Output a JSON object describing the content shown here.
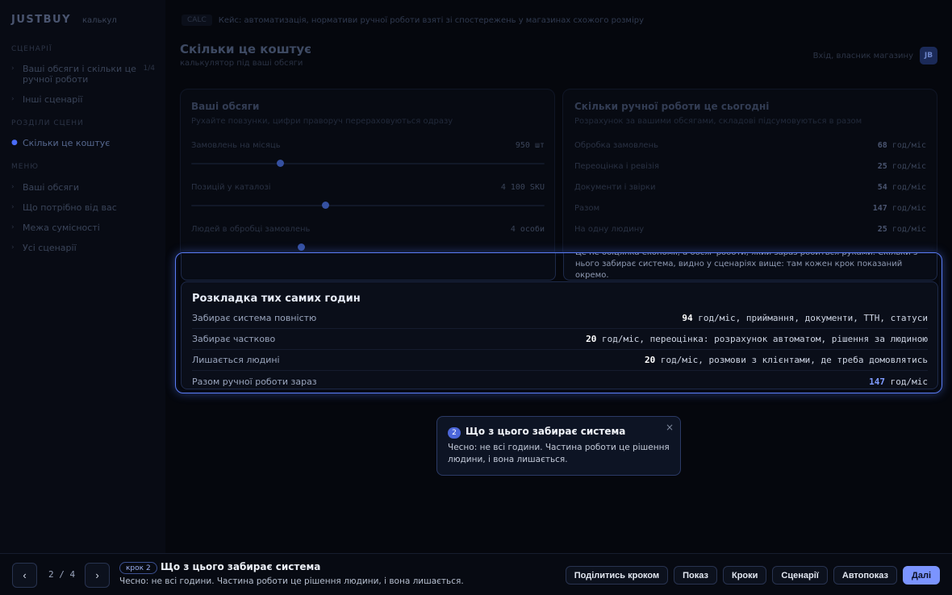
{
  "sidebar": {
    "brand": "JUSTBUY",
    "brand_sub": "калькул",
    "groups": [
      "СЦЕНАРІЇ",
      "РОЗДІЛИ СЦЕНИ",
      "МЕНЮ"
    ],
    "items": [
      {
        "label": "Ваші обсяги і скільки це ручної роботи",
        "count": "1/4"
      },
      {
        "label": "Інші сценарії"
      },
      {
        "label": "Скільки це коштує"
      },
      {
        "label": "Ваші обсяги"
      },
      {
        "label": "Що потрібно від вас"
      },
      {
        "label": "Межа сумісності"
      },
      {
        "label": "Усі сценарії"
      }
    ]
  },
  "header": {
    "crumb_tag": "CALC",
    "crumb": "Кейс: автоматизація, нормативи ручної роботи взяті зі спостережень у магазинах схожого розміру",
    "title": "Скільки це коштує",
    "subtitle": "калькулятор під ваші обсяги",
    "login_label": "Вхід, власник магазину",
    "avatar": "JB"
  },
  "volumes_card": {
    "title": "Ваші обсяги",
    "subtitle": "Рухайте повзунки, цифри праворуч перераховуються одразу",
    "rows": [
      {
        "label": "Замовлень на місяць",
        "value": "950 шт",
        "level": 0.25
      },
      {
        "label": "Позицій у каталозі",
        "value": "4 100 SKU",
        "level": 0.38
      },
      {
        "label": "Людей в обробці замовлень",
        "value": "4 особи",
        "level": 0.31
      }
    ]
  },
  "manual_card": {
    "title": "Скільки ручної роботи це сьогодні",
    "subtitle": "Розрахунок за вашими обсягами, складові підсумовуються в разом",
    "rows": [
      {
        "label": "Обробка замовлень",
        "value": "68",
        "unit": "год/міс"
      },
      {
        "label": "Переоцінка і ревізія",
        "value": "25",
        "unit": "год/міс"
      },
      {
        "label": "Документи і звірки",
        "value": "54",
        "unit": "год/міс"
      },
      {
        "label": "Разом",
        "value": "147",
        "unit": "год/міс"
      },
      {
        "label": "На одну людину",
        "value": "25",
        "unit": "год/міс"
      }
    ],
    "note": "Це не обіцянка економії, а обсяг роботи, який зараз робиться руками. Скільки з нього забирає система, видно у сценаріях вище: там кожен крок показаний окремо."
  },
  "breakdown": {
    "title": "Розкладка тих самих годин",
    "rows": [
      {
        "label": "Забирає система повністю",
        "value": "94",
        "detail": " год/міс, приймання, документи, ТТН, статуси"
      },
      {
        "label": "Забирає частково",
        "value": "20",
        "detail": " год/міс, переоцінка: розрахунок автоматом, рішення за людиною"
      },
      {
        "label": "Лишається людині",
        "value": "20",
        "detail": " год/міс, розмови з клієнтами, де треба домовлятись"
      },
      {
        "label": "Разом ручної роботи зараз",
        "value": "147",
        "detail": " год/міс"
      }
    ]
  },
  "popover": {
    "number": "2",
    "title": "Що з цього забирає система",
    "text": "Чесно: не всі години. Частина роботи це рішення людини, і вона лишається.",
    "close": "×"
  },
  "bottombar": {
    "prev": "‹",
    "next": "›",
    "pager": "2 / 4",
    "step_badge": "крок 2",
    "step_title": "Що з цього забирає система",
    "step_text": "Чесно: не всі години. Частина роботи це рішення людини, і вона лишається.",
    "actions": [
      "Поділитись кроком",
      "Показ",
      "Кроки",
      "Сценарії",
      "Автопоказ",
      "Далі"
    ]
  },
  "colors": {
    "accent": "#7b94ff",
    "highlight_border": "#5a7cf5",
    "background": "#05070d"
  }
}
